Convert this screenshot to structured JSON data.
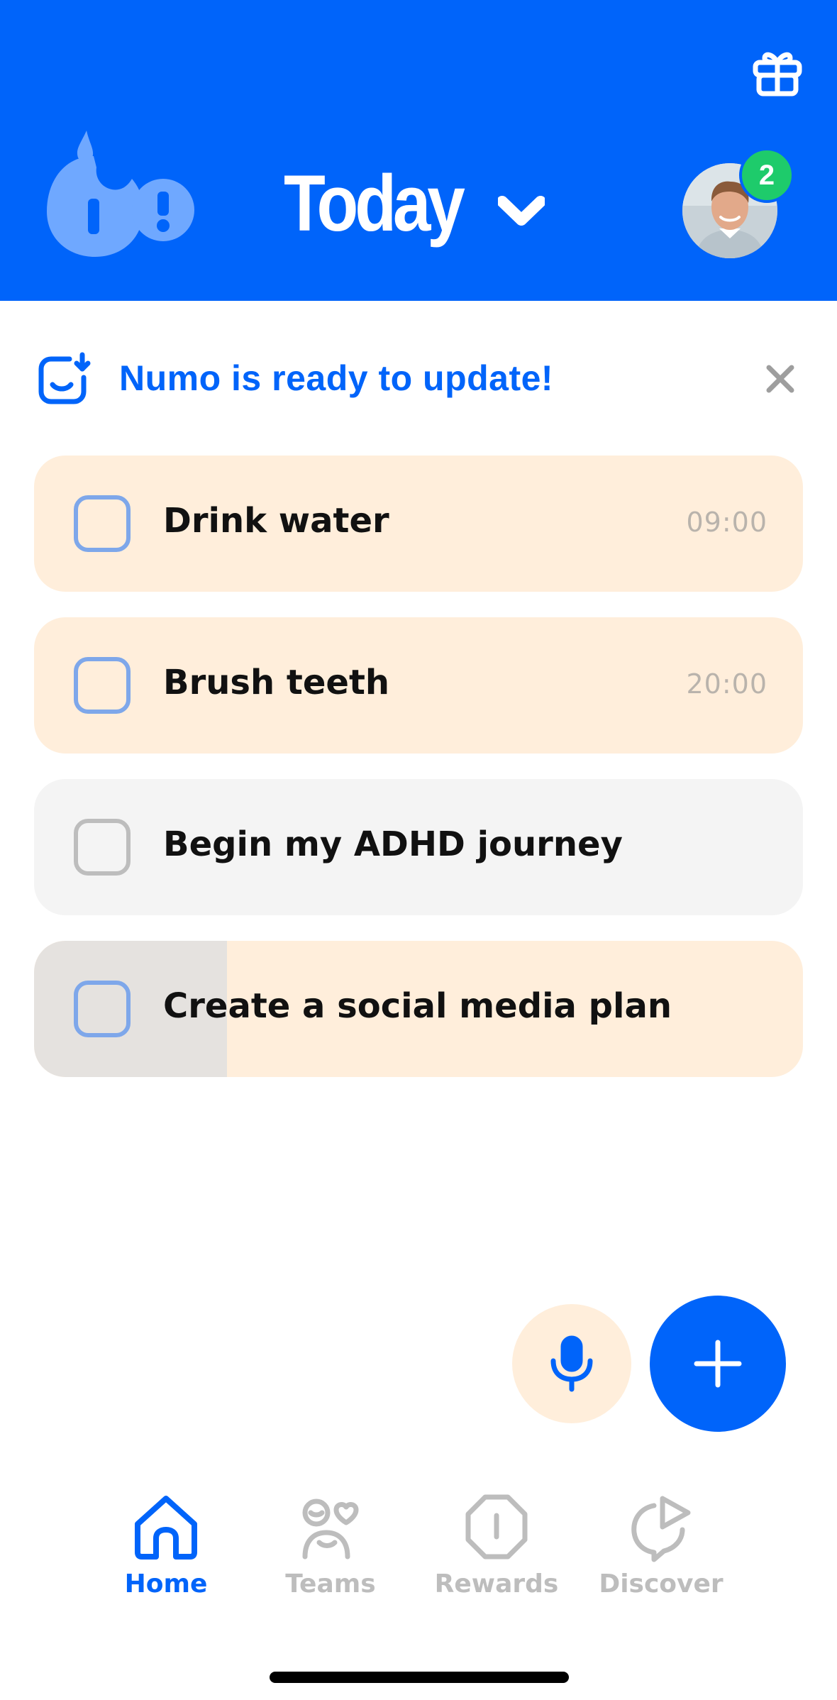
{
  "colors": {
    "brand_blue": "#0064FA",
    "peach": "#FFEEDB",
    "gray_card": "#F4F4F4",
    "badge_green": "#1ECB6B",
    "inactive": "#BDBDBD"
  },
  "header": {
    "title": "Today",
    "gift_icon": "gift-icon",
    "chevron_icon": "chevron-down-icon",
    "avatar_badge_count": "2"
  },
  "update_banner": {
    "text": "Numo is ready to update!",
    "icon": "update-download-icon",
    "close_icon": "close-icon"
  },
  "tasks": [
    {
      "label": "Drink water",
      "time": "09:00",
      "style": "peach",
      "checked": false
    },
    {
      "label": "Brush teeth",
      "time": "20:00",
      "style": "peach",
      "checked": false
    },
    {
      "label": "Begin my ADHD journey",
      "time": "",
      "style": "gray",
      "checked": false
    },
    {
      "label": "Create a social media plan",
      "time": "",
      "style": "peach",
      "checked": false
    }
  ],
  "actions": {
    "mic_icon": "microphone-icon",
    "add_icon": "plus-icon"
  },
  "nav": {
    "items": [
      {
        "label": "Home",
        "icon": "home-icon",
        "active": true
      },
      {
        "label": "Teams",
        "icon": "teams-icon",
        "active": false
      },
      {
        "label": "Rewards",
        "icon": "rewards-icon",
        "active": false
      },
      {
        "label": "Discover",
        "icon": "discover-icon",
        "active": false
      }
    ]
  }
}
